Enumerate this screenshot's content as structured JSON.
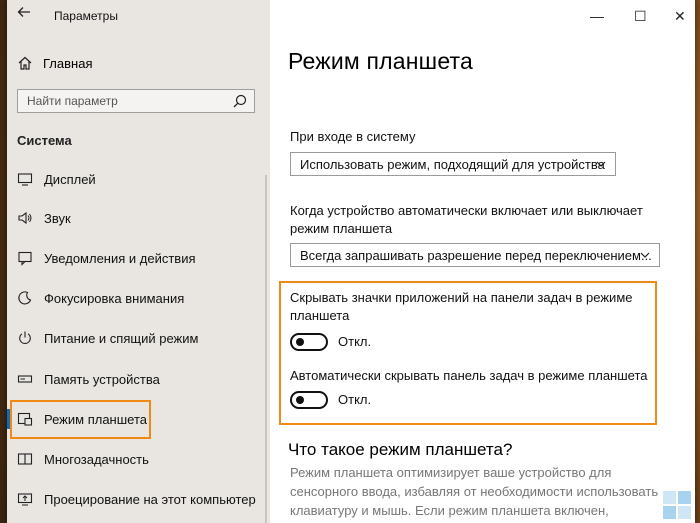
{
  "window": {
    "title": "Параметры",
    "back_icon": "back-arrow-icon",
    "minimize": "—",
    "maximize": "☐",
    "close": "✕"
  },
  "sidebar": {
    "home_label": "Главная",
    "search_placeholder": "Найти параметр",
    "section_title": "Система",
    "items": [
      {
        "label": "Дисплей",
        "icon": "display-icon"
      },
      {
        "label": "Звук",
        "icon": "sound-icon"
      },
      {
        "label": "Уведомления и действия",
        "icon": "notifications-icon"
      },
      {
        "label": "Фокусировка внимания",
        "icon": "focus-assist-icon"
      },
      {
        "label": "Питание и спящий режим",
        "icon": "power-icon"
      },
      {
        "label": "Память устройства",
        "icon": "storage-icon"
      },
      {
        "label": "Режим планшета",
        "icon": "tablet-mode-icon",
        "active": true
      },
      {
        "label": "Многозадачность",
        "icon": "multitasking-icon"
      },
      {
        "label": "Проецирование на этот компьютер",
        "icon": "projecting-icon"
      }
    ]
  },
  "main": {
    "title": "Режим планшета",
    "signin": {
      "label": "При входе в систему",
      "value": "Использовать режим, подходящий для устройства"
    },
    "auto_switch": {
      "label": "Когда устройство автоматически включает или выключает режим планшета",
      "value": "Всегда запрашивать разрешение перед переключением..."
    },
    "hide_icons": {
      "label": "Скрывать значки приложений на панели задач в режиме планшета",
      "state": "Откл."
    },
    "hide_taskbar": {
      "label": "Автоматически скрывать панель задач в режиме планшета",
      "state": "Откл."
    },
    "about_title": "Что такое режим планшета?",
    "about_text": "Режим планшета оптимизирует ваше устройство для сенсорного ввода, избавляя от необходимости использовать клавиатуру и мышь. Если режим планшета включен, приложения..."
  },
  "colors": {
    "highlight": "#ef8a17",
    "accent": "#0f6cbd"
  }
}
